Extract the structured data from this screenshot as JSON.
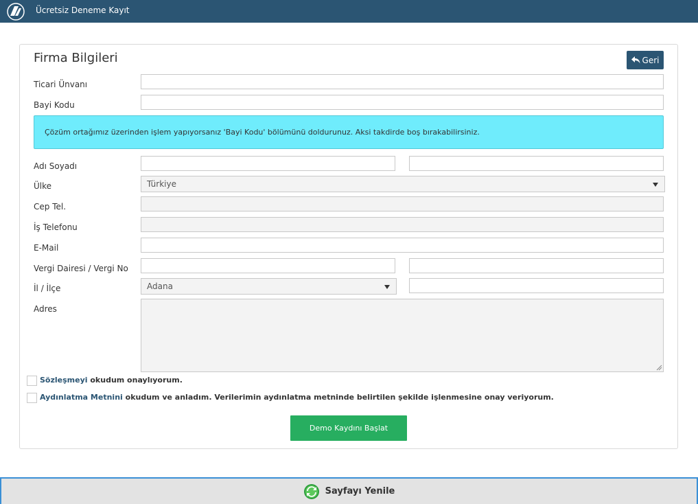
{
  "header": {
    "title": "Ücretsiz Deneme Kayıt",
    "logo_icon": "company-logo-icon"
  },
  "panel": {
    "title": "Firma Bilgileri",
    "back_label": "Geri"
  },
  "fields": {
    "ticari_unvan": "Ticari Ünvanı",
    "bayi_kodu": "Bayi Kodu",
    "adi_soyadi": "Adı Soyadı",
    "ulke": "Ülke",
    "cep_tel": "Cep Tel.",
    "is_telefonu": "İş Telefonu",
    "email": "E-Mail",
    "vergi": "Vergi Dairesi / Vergi No",
    "il_ilce": "İl / İlçe",
    "adres": "Adres"
  },
  "info_text": "Çözüm ortağımız üzerinden işlem yapıyorsanız 'Bayi Kodu' bölümünü doldurunuz. Aksi takdirde boş bırakabilirsiniz.",
  "selects": {
    "ulke_value": "Türkiye",
    "il_value": "Adana"
  },
  "consents": {
    "contract_link": "Sözleşmeyi",
    "contract_rest": " okudum onaylıyorum.",
    "privacy_link": "Aydınlatma Metnini",
    "privacy_rest": " okudum ve anladım. Verilerimin aydınlatma metninde belirtilen şekilde işlenmesine onay veriyorum."
  },
  "submit_label": "Demo Kaydını Başlat",
  "footer": {
    "refresh_label": "Sayfayı Yenile",
    "refresh_icon": "refresh-icon"
  },
  "colors": {
    "brand": "#2b5573",
    "info": "#6fecfc",
    "success": "#27ae60",
    "footer_border": "#3a8fd6"
  }
}
